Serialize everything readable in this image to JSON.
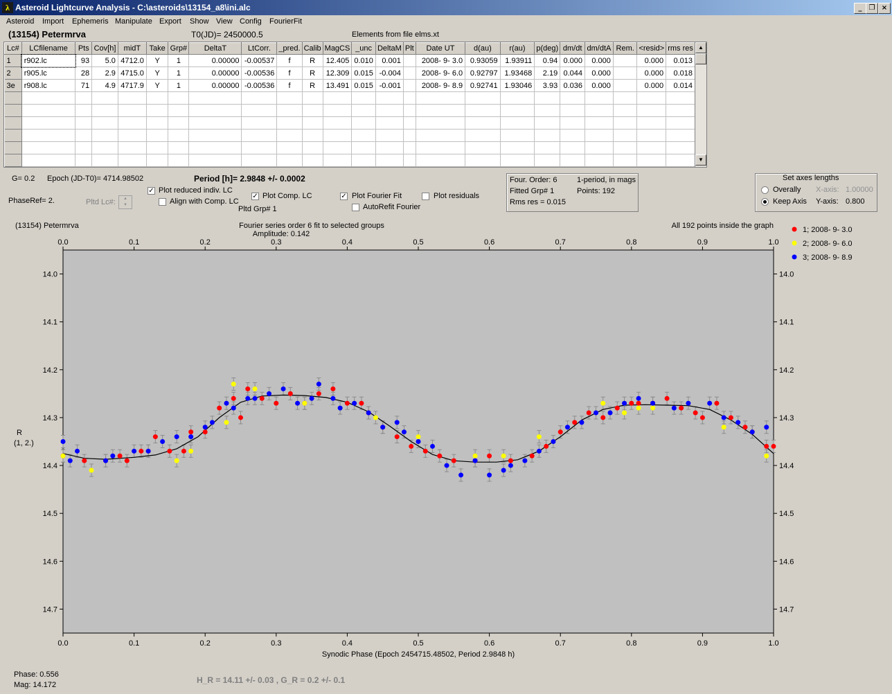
{
  "window": {
    "title": "Asteroid Lightcurve Analysis - C:\\asteroids\\13154_a8\\ini.alc",
    "icon": "app-logo",
    "controls": [
      "minimize-icon",
      "restore-icon",
      "close-icon"
    ]
  },
  "menu": [
    "Asteroid",
    "Import",
    "Ephemeris",
    "Manipulate",
    "Export",
    "Show",
    "View",
    "Config",
    "FourierFit"
  ],
  "header": {
    "asteroid_name": "(13154) Petermrva",
    "t0": "T0(JD)= 2450000.5",
    "elements": "Elements from file elms.xt"
  },
  "table": {
    "columns": [
      "Lc#",
      "LCfilename",
      "Pts",
      "Cov[h]",
      "midT",
      "Take",
      "Grp#",
      "DeltaT",
      "LtCorr.",
      "_pred.",
      "Calib",
      "MagCS",
      "_unc",
      "DeltaM",
      "Plt",
      "Date UT",
      "d(au)",
      "r(au)",
      "p(deg)",
      "dm/dt",
      "dm/dtA",
      "Rem.",
      "<resid>",
      "rms res"
    ],
    "rows": [
      [
        "1",
        "r902.lc",
        "93",
        "5.0",
        "4712.0",
        "Y",
        "1",
        "0.00000",
        "-0.00537",
        "f",
        "R",
        "12.405",
        "0.010",
        "0.001",
        "",
        "2008- 9- 3.0",
        "0.93059",
        "1.93911",
        "0.94",
        "0.000",
        "0.000",
        "",
        "0.000",
        "0.013"
      ],
      [
        "2",
        "r905.lc",
        "28",
        "2.9",
        "4715.0",
        "Y",
        "1",
        "0.00000",
        "-0.00536",
        "f",
        "R",
        "12.309",
        "0.015",
        "-0.004",
        "",
        "2008- 9- 6.0",
        "0.92797",
        "1.93468",
        "2.19",
        "0.044",
        "0.000",
        "",
        "0.000",
        "0.018"
      ],
      [
        "3e",
        "r908.lc",
        "71",
        "4.9",
        "4717.9",
        "Y",
        "1",
        "0.00000",
        "-0.00536",
        "f",
        "R",
        "13.491",
        "0.015",
        "-0.001",
        "",
        "2008- 9- 8.9",
        "0.92741",
        "1.93046",
        "3.93",
        "0.036",
        "0.000",
        "",
        "0.000",
        "0.014"
      ]
    ]
  },
  "controls": {
    "g": "G= 0.2",
    "epoch": "Epoch (JD-T0)= 4714.98502",
    "period": "Period [h]= 2.9848 +/- 0.0002",
    "phaseref": "PhaseRef= 2.",
    "pltd_lc": "Pltd Lc#:",
    "plot_reduced": "Plot reduced indiv. LC",
    "align_comp": "Align with Comp. LC",
    "plot_comp": "Plot Comp. LC",
    "pltd_grp": "Pltd Grp#  1",
    "plot_fourier": "Plot Fourier Fit",
    "autorefit": "AutoRefit Fourier",
    "plot_residuals": "Plot residuals",
    "checked": {
      "plot_reduced": true,
      "align_comp": false,
      "plot_comp": true,
      "plot_fourier": true,
      "autorefit": false,
      "plot_residuals": false
    }
  },
  "fourier_info": {
    "order": "Four. Order:  6",
    "mode": "1-period, in mags",
    "fitted": "Fitted Grp# 1",
    "points": "Points: 192",
    "rms": "Rms res     = 0.015"
  },
  "axes_box": {
    "title": "Set axes lengths",
    "overally": "Overally",
    "keep_axis": "Keep Axis",
    "x_label": "X-axis:",
    "x_value": "1.00000",
    "y_label": "Y-axis:",
    "y_value": "0.800",
    "selected": "Keep Axis"
  },
  "plot": {
    "name": "(13154) Petermrva",
    "fit_title": "Fourier series order 6 fit to selected groups",
    "amplitude": "Amplitude: 0.142",
    "points_note": "All 192 points inside the graph",
    "ylabel": "R",
    "ylabel2": "(1, 2.)",
    "xlabel": "Synodic Phase (Epoch 2454715.48502, Period 2.9848 h)"
  },
  "chart_data": {
    "type": "scatter",
    "title": "Fourier series order 6 fit to selected groups",
    "xlabel": "Synodic Phase (Epoch 2454715.48502, Period 2.9848 h)",
    "ylabel": "R (1, 2.)",
    "xlim": [
      0.0,
      1.0
    ],
    "ylim": [
      14.75,
      13.95
    ],
    "y_inverted": true,
    "x_ticks": [
      "0.0",
      "0.1",
      "0.2",
      "0.3",
      "0.4",
      "0.5",
      "0.6",
      "0.7",
      "0.8",
      "0.9",
      "1.0"
    ],
    "y_ticks": [
      "14.0",
      "14.1",
      "14.2",
      "14.3",
      "14.4",
      "14.5",
      "14.6",
      "14.7"
    ],
    "legend_position": "top-right, outside plot",
    "series": [
      {
        "name": "1; 2008- 9- 3.0",
        "color": "#ff0000",
        "points": [
          [
            0.0,
            14.38
          ],
          [
            0.03,
            14.39
          ],
          [
            0.06,
            14.39
          ],
          [
            0.08,
            14.38
          ],
          [
            0.09,
            14.39
          ],
          [
            0.11,
            14.37
          ],
          [
            0.12,
            14.37
          ],
          [
            0.13,
            14.34
          ],
          [
            0.15,
            14.37
          ],
          [
            0.17,
            14.37
          ],
          [
            0.18,
            14.33
          ],
          [
            0.2,
            14.33
          ],
          [
            0.22,
            14.28
          ],
          [
            0.24,
            14.26
          ],
          [
            0.25,
            14.3
          ],
          [
            0.26,
            14.24
          ],
          [
            0.28,
            14.26
          ],
          [
            0.3,
            14.27
          ],
          [
            0.32,
            14.25
          ],
          [
            0.34,
            14.27
          ],
          [
            0.36,
            14.25
          ],
          [
            0.38,
            14.24
          ],
          [
            0.4,
            14.27
          ],
          [
            0.42,
            14.27
          ],
          [
            0.43,
            14.29
          ],
          [
            0.45,
            14.32
          ],
          [
            0.47,
            14.34
          ],
          [
            0.49,
            14.36
          ],
          [
            0.51,
            14.37
          ],
          [
            0.53,
            14.38
          ],
          [
            0.55,
            14.39
          ],
          [
            0.58,
            14.39
          ],
          [
            0.6,
            14.38
          ],
          [
            0.63,
            14.39
          ],
          [
            0.66,
            14.38
          ],
          [
            0.68,
            14.36
          ],
          [
            0.7,
            14.33
          ],
          [
            0.72,
            14.31
          ],
          [
            0.74,
            14.29
          ],
          [
            0.76,
            14.3
          ],
          [
            0.78,
            14.28
          ],
          [
            0.8,
            14.27
          ],
          [
            0.81,
            14.27
          ],
          [
            0.83,
            14.27
          ],
          [
            0.85,
            14.26
          ],
          [
            0.87,
            14.28
          ],
          [
            0.89,
            14.29
          ],
          [
            0.9,
            14.3
          ],
          [
            0.92,
            14.27
          ],
          [
            0.94,
            14.3
          ],
          [
            0.96,
            14.32
          ],
          [
            0.97,
            14.33
          ],
          [
            0.99,
            14.36
          ],
          [
            1.0,
            14.36
          ]
        ]
      },
      {
        "name": "2; 2008- 9- 6.0",
        "color": "#ffff00",
        "points": [
          [
            0.0,
            14.38
          ],
          [
            0.04,
            14.41
          ],
          [
            0.16,
            14.39
          ],
          [
            0.18,
            14.37
          ],
          [
            0.23,
            14.31
          ],
          [
            0.24,
            14.23
          ],
          [
            0.27,
            14.24
          ],
          [
            0.34,
            14.27
          ],
          [
            0.44,
            14.3
          ],
          [
            0.5,
            14.34
          ],
          [
            0.58,
            14.38
          ],
          [
            0.62,
            14.38
          ],
          [
            0.67,
            14.34
          ],
          [
            0.76,
            14.27
          ],
          [
            0.79,
            14.29
          ],
          [
            0.81,
            14.28
          ],
          [
            0.83,
            14.28
          ],
          [
            0.93,
            14.32
          ],
          [
            0.99,
            14.38
          ]
        ]
      },
      {
        "name": "3; 2008- 9- 8.9",
        "color": "#0000ff",
        "points": [
          [
            0.0,
            14.35
          ],
          [
            0.01,
            14.39
          ],
          [
            0.02,
            14.37
          ],
          [
            0.06,
            14.39
          ],
          [
            0.07,
            14.38
          ],
          [
            0.1,
            14.37
          ],
          [
            0.12,
            14.37
          ],
          [
            0.14,
            14.35
          ],
          [
            0.16,
            14.34
          ],
          [
            0.18,
            14.34
          ],
          [
            0.2,
            14.32
          ],
          [
            0.21,
            14.31
          ],
          [
            0.23,
            14.27
          ],
          [
            0.24,
            14.28
          ],
          [
            0.26,
            14.26
          ],
          [
            0.27,
            14.26
          ],
          [
            0.29,
            14.25
          ],
          [
            0.31,
            14.24
          ],
          [
            0.33,
            14.27
          ],
          [
            0.35,
            14.26
          ],
          [
            0.36,
            14.23
          ],
          [
            0.38,
            14.26
          ],
          [
            0.39,
            14.28
          ],
          [
            0.41,
            14.27
          ],
          [
            0.43,
            14.29
          ],
          [
            0.45,
            14.32
          ],
          [
            0.47,
            14.31
          ],
          [
            0.48,
            14.33
          ],
          [
            0.5,
            14.35
          ],
          [
            0.52,
            14.36
          ],
          [
            0.54,
            14.4
          ],
          [
            0.56,
            14.42
          ],
          [
            0.58,
            14.39
          ],
          [
            0.6,
            14.42
          ],
          [
            0.62,
            14.41
          ],
          [
            0.63,
            14.4
          ],
          [
            0.65,
            14.39
          ],
          [
            0.67,
            14.37
          ],
          [
            0.69,
            14.35
          ],
          [
            0.71,
            14.32
          ],
          [
            0.73,
            14.31
          ],
          [
            0.75,
            14.29
          ],
          [
            0.77,
            14.29
          ],
          [
            0.79,
            14.27
          ],
          [
            0.81,
            14.26
          ],
          [
            0.83,
            14.27
          ],
          [
            0.86,
            14.28
          ],
          [
            0.88,
            14.27
          ],
          [
            0.91,
            14.27
          ],
          [
            0.93,
            14.3
          ],
          [
            0.95,
            14.31
          ],
          [
            0.97,
            14.33
          ],
          [
            0.99,
            14.32
          ]
        ]
      }
    ],
    "fit_line": {
      "name": "Fourier fit",
      "color": "#000000",
      "points": [
        [
          0.0,
          14.375
        ],
        [
          0.03,
          14.385
        ],
        [
          0.06,
          14.387
        ],
        [
          0.1,
          14.383
        ],
        [
          0.13,
          14.378
        ],
        [
          0.16,
          14.365
        ],
        [
          0.19,
          14.34
        ],
        [
          0.22,
          14.3
        ],
        [
          0.25,
          14.268
        ],
        [
          0.28,
          14.255
        ],
        [
          0.31,
          14.253
        ],
        [
          0.34,
          14.254
        ],
        [
          0.37,
          14.258
        ],
        [
          0.4,
          14.268
        ],
        [
          0.43,
          14.288
        ],
        [
          0.46,
          14.318
        ],
        [
          0.49,
          14.35
        ],
        [
          0.52,
          14.377
        ],
        [
          0.55,
          14.39
        ],
        [
          0.58,
          14.393
        ],
        [
          0.61,
          14.393
        ],
        [
          0.64,
          14.388
        ],
        [
          0.67,
          14.37
        ],
        [
          0.7,
          14.34
        ],
        [
          0.73,
          14.305
        ],
        [
          0.76,
          14.283
        ],
        [
          0.79,
          14.274
        ],
        [
          0.82,
          14.273
        ],
        [
          0.85,
          14.274
        ],
        [
          0.88,
          14.275
        ],
        [
          0.91,
          14.283
        ],
        [
          0.94,
          14.305
        ],
        [
          0.97,
          14.335
        ],
        [
          1.0,
          14.375
        ]
      ]
    }
  },
  "status": {
    "phase": "Phase:  0.556",
    "mag": "Mag:    14.172",
    "h_g": "H_R = 14.11 +/- 0.03  , G_R = 0.2 +/- 0.1"
  }
}
